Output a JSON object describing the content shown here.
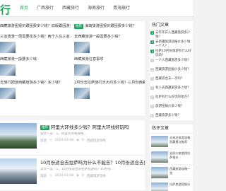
{
  "header": {
    "logo_text": "行",
    "nav": [
      {
        "label": "首页",
        "active": true
      },
      {
        "label": "广西旅行"
      },
      {
        "label": "西藏旅行"
      },
      {
        "label": "海南旅行"
      },
      {
        "label": "青海旅行"
      }
    ]
  },
  "grid_cards": [
    {
      "tag": "",
      "title": "西藏旅游团报价跟团费多少钱？旧版跟团游多少钱？",
      "excerpt": "",
      "thumb": false
    },
    {
      "tag": "推荐",
      "title": "海南旅游团报价跟团费多少钱？",
      "excerpt": "",
      "thumb": false
    },
    {
      "tag": "",
      "title": "西藏旅游一般要多少钱",
      "excerpt": "",
      "thumb": true
    },
    {
      "tag": "",
      "title": "西藏旅游注意事项",
      "excerpt": "",
      "thumb": true
    },
    {
      "tag": "",
      "title": "三亚旅游一周需要花多少钱？两个人在三亚...",
      "excerpt": "",
      "thumb": false
    },
    {
      "tag": "",
      "title": "去西藏旅游一般需要多少钱？",
      "excerpt": "",
      "thumb": false
    },
    {
      "tag": "",
      "title": "",
      "excerpt": "",
      "thumb": true
    },
    {
      "tag": "",
      "title": "",
      "excerpt": "",
      "thumb": true
    },
    {
      "tag": "",
      "title": "去旅行团游西藏旅游多少钱？多少钱？",
      "excerpt": "",
      "thumb": false
    },
    {
      "tag": "",
      "title": "2月份去拉萨旅行天大约多少钱？三月份西藏...",
      "excerpt": "",
      "thumb": false
    }
  ],
  "articles": [
    {
      "tag": "推荐",
      "title": "阿里大环线多少钱？阿里大环线好玩吗",
      "excerpt": "常文一览：1、阿里大环线攻略...",
      "author": "旅游",
      "date": "2024-03-08",
      "views": "0",
      "category": "西藏旅游攻略"
    },
    {
      "tag": "",
      "title": "10月份适合去拉萨吗为什么不能去？10月份适合去拉萨吗",
      "excerpt": "常文一览：1、10月份适合去拉萨旅游吗？10月份...",
      "author": "旅游",
      "date": "2024-03-08",
      "views": "0",
      "category": "西藏旅游攻略"
    }
  ],
  "sidebar": {
    "hot_title": "热门文章",
    "hot": [
      {
        "num": "1",
        "text": "去年年开入西藏旅游多少钱？"
      },
      {
        "num": "2",
        "text": "去新疆旅游团报价多少钱一个人？"
      },
      {
        "num": "3",
        "text": "拉萨10月份旅游有什么好玩的？"
      },
      {
        "num": "4",
        "text": "一个人西藏旅游多少钱？"
      },
      {
        "num": "5",
        "text": "西藏旅游团报价多少钱？"
      },
      {
        "num": "6",
        "text": "西藏适合去一次吗？"
      },
      {
        "num": "7",
        "text": "有人去西藏旅游多少钱？"
      },
      {
        "num": "8",
        "text": "拉萨有什么好玩的地方？"
      },
      {
        "num": "9",
        "text": "旅游团报价多少钱？"
      },
      {
        "num": "10",
        "text": "西藏旅游多少钱？"
      }
    ],
    "rec_title": "热评文章",
    "rec": [
      {
        "text": "去林芝旅游攻略西藏景点推荐"
      },
      {
        "text": "去四川旅游团拉萨报价"
      },
      {
        "text": "西藏旅游攻略一览"
      },
      {
        "text": "拉萨旅游团报价"
      }
    ]
  }
}
